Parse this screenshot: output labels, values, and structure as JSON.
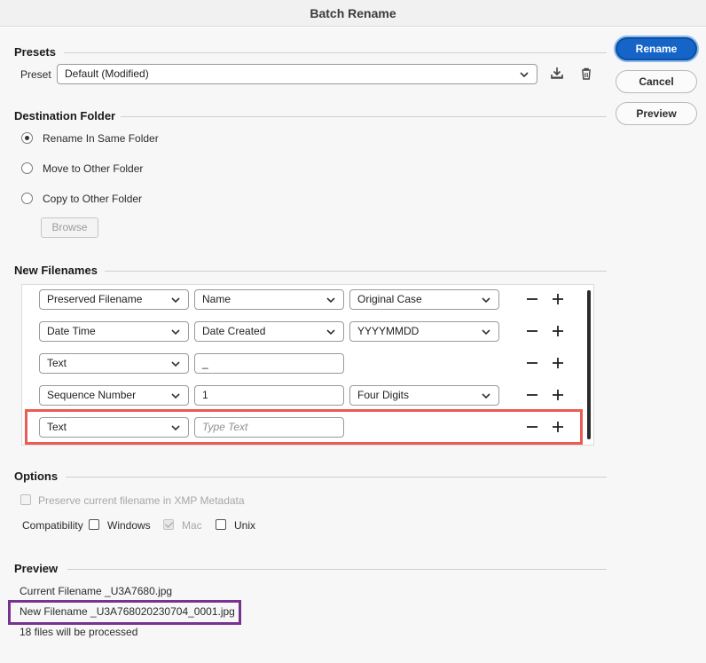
{
  "window": {
    "title": "Batch Rename"
  },
  "buttons": {
    "rename": "Rename",
    "cancel": "Cancel",
    "preview": "Preview",
    "browse": "Browse"
  },
  "presets": {
    "section_title": "Presets",
    "preset_label": "Preset",
    "preset_value": "Default (Modified)"
  },
  "destination": {
    "section_title": "Destination Folder",
    "options": [
      "Rename In Same Folder",
      "Move to Other Folder",
      "Copy to Other Folder"
    ],
    "selected": "Rename In Same Folder"
  },
  "new_filenames": {
    "section_title": "New Filenames",
    "rows": [
      {
        "type": "Preserved Filename",
        "field2": "Name",
        "field3": "Original Case"
      },
      {
        "type": "Date Time",
        "field2": "Date Created",
        "field3": "YYYYMMDD"
      },
      {
        "type": "Text",
        "field2": "_",
        "field3": ""
      },
      {
        "type": "Sequence Number",
        "field2": "1",
        "field3": "Four Digits"
      },
      {
        "type": "Text",
        "field2_placeholder": "Type Text",
        "field3": ""
      }
    ]
  },
  "options": {
    "section_title": "Options",
    "preserve_xmp": "Preserve current filename in XMP Metadata",
    "compatibility_label": "Compatibility",
    "windows": "Windows",
    "mac": "Mac",
    "unix": "Unix"
  },
  "preview": {
    "section_title": "Preview",
    "current_filename": "Current Filename _U3A7680.jpg",
    "new_filename": "New Filename _U3A768020230704_0001.jpg",
    "files_count": "18 files will be processed"
  },
  "colors": {
    "accent": "#1565c8",
    "highlight_red": "#ea5b55",
    "highlight_purple": "#76338f"
  }
}
